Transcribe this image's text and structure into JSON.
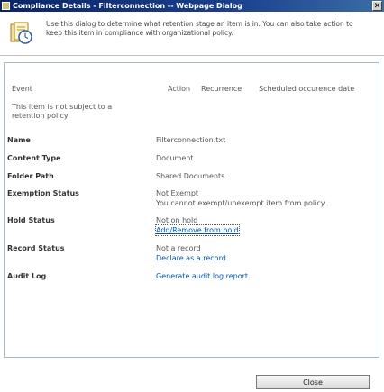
{
  "window": {
    "title": "Compliance Details - Filterconnection -- Webpage Dialog",
    "close_glyph": "✕"
  },
  "header": {
    "description": "Use this dialog to determine what retention stage an item is in. You can also take action to keep this item in compliance with organizational policy."
  },
  "events_table": {
    "columns": [
      "Event",
      "Action",
      "Recurrence",
      "Scheduled occurence date"
    ],
    "note": "This item is not subject to a retention policy"
  },
  "details": {
    "name": {
      "label": "Name",
      "value": "Filterconnection.txt"
    },
    "content_type": {
      "label": "Content Type",
      "value": "Document"
    },
    "folder_path": {
      "label": "Folder Path",
      "value": "Shared Documents"
    },
    "exemption_status": {
      "label": "Exemption Status",
      "value": "Not Exempt",
      "detail": "You cannot exempt/unexempt item from policy."
    },
    "hold_status": {
      "label": "Hold Status",
      "value": "Not on hold",
      "link": "Add/Remove from hold"
    },
    "record_status": {
      "label": "Record Status",
      "value": "Not a record",
      "link": "Declare as a record"
    },
    "audit_log": {
      "label": "Audit Log",
      "link": "Generate audit log report"
    }
  },
  "footer": {
    "close_label": "Close"
  },
  "colors": {
    "titlebar": "#0a246a",
    "link": "#0055aa",
    "panel_border": "#a5b8d0"
  },
  "icons": {
    "window": "dialog-icon",
    "header": "document-with-clock-icon"
  }
}
